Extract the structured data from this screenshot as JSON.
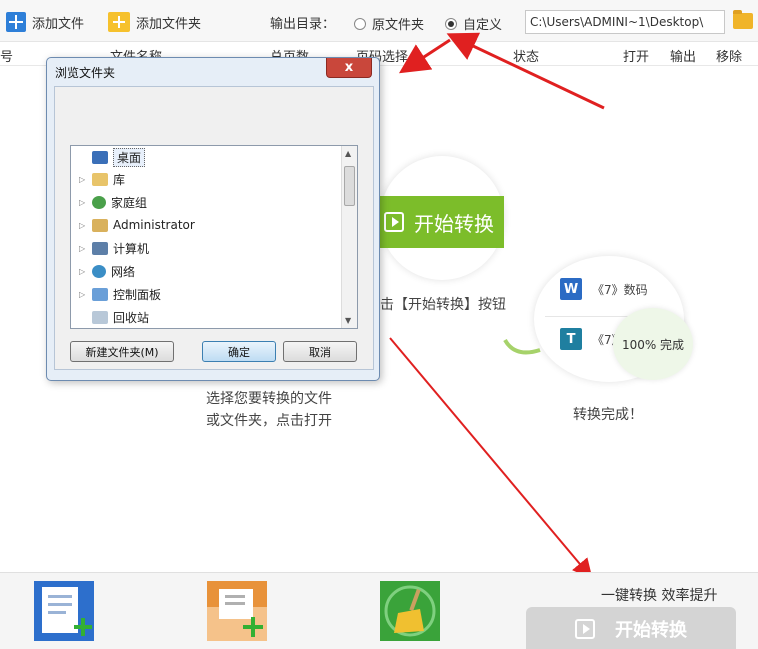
{
  "toolbar": {
    "add_file": "添加文件",
    "add_folder": "添加文件夹",
    "output_label": "输出目录：",
    "radio_original": "原文件夹",
    "radio_custom": "自定义",
    "path_value": "C:\\Users\\ADMINI~1\\Desktop\\"
  },
  "table_headers": {
    "index": "号",
    "file_name": "文件名称",
    "total_pages": "总页数",
    "page_select": "页码选择",
    "status": "状态",
    "open": "打开",
    "output": "输出",
    "remove": "移除"
  },
  "guide": {
    "start_button_demo": "开始转换",
    "click_start_text": "击【开始转换】按钮",
    "doc_word": "《7》数码",
    "doc_other": "《7》",
    "progress_text": "100%  完成",
    "done_text": "转换完成！",
    "select_line1": "选择您要转换的文件",
    "select_line2": "或文件夹，点击打开"
  },
  "dialog": {
    "title": "浏览文件夹",
    "close": "x",
    "tree": [
      "桌面",
      "库",
      "家庭组",
      "Administrator",
      "计算机",
      "网络",
      "控制面板",
      "回收站"
    ],
    "new_folder": "新建文件夹(M)",
    "ok": "确定",
    "cancel": "取消"
  },
  "bottom": {
    "slogan": "一键转换  效率提升",
    "start": "开始转换"
  },
  "colors": {
    "accent_green": "#7cbd2a",
    "arrow_red": "#e02020",
    "dialog_close": "#c9473b"
  }
}
